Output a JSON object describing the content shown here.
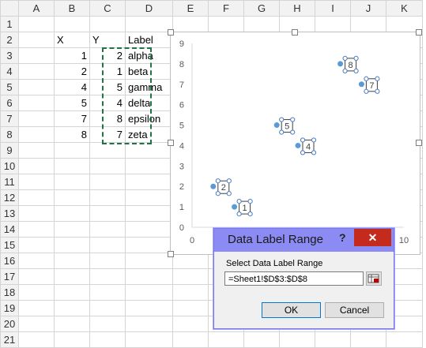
{
  "columns": [
    "A",
    "B",
    "C",
    "D",
    "E",
    "F",
    "G",
    "H",
    "I",
    "J",
    "K"
  ],
  "rows": [
    "1",
    "2",
    "3",
    "4",
    "5",
    "6",
    "7",
    "8",
    "9",
    "10",
    "11",
    "12",
    "13",
    "14",
    "15",
    "16",
    "17",
    "18",
    "19",
    "20",
    "21"
  ],
  "headers": {
    "x": "X",
    "y": "Y",
    "label": "Label"
  },
  "table": [
    {
      "x": "1",
      "y": "2",
      "label": "alpha"
    },
    {
      "x": "2",
      "y": "1",
      "label": "beta"
    },
    {
      "x": "4",
      "y": "5",
      "label": "gamma"
    },
    {
      "x": "5",
      "y": "4",
      "label": "delta"
    },
    {
      "x": "7",
      "y": "8",
      "label": "epsilon"
    },
    {
      "x": "8",
      "y": "7",
      "label": "zeta"
    }
  ],
  "chart_data": {
    "type": "scatter",
    "title": "",
    "xlabel": "",
    "ylabel": "",
    "xlim": [
      0,
      10
    ],
    "ylim": [
      0,
      9
    ],
    "x_ticks": [
      "0",
      "10"
    ],
    "y_ticks": [
      "0",
      "1",
      "2",
      "3",
      "4",
      "5",
      "6",
      "7",
      "8",
      "9"
    ],
    "series": [
      {
        "x": [
          1,
          2,
          4,
          5,
          7,
          8
        ],
        "y": [
          2,
          1,
          5,
          4,
          8,
          7
        ],
        "labels": [
          "2",
          "1",
          "5",
          "4",
          "8",
          "7"
        ]
      }
    ],
    "point_color": "#5b9bd5",
    "grid": false
  },
  "dialog": {
    "title": "Data Label Range",
    "help": "?",
    "close": "✕",
    "prompt": "Select Data Label Range",
    "input_value": "=Sheet1!$D$3:$D$8",
    "ok": "OK",
    "cancel": "Cancel",
    "collapse_icon": "range-collapse-icon"
  }
}
